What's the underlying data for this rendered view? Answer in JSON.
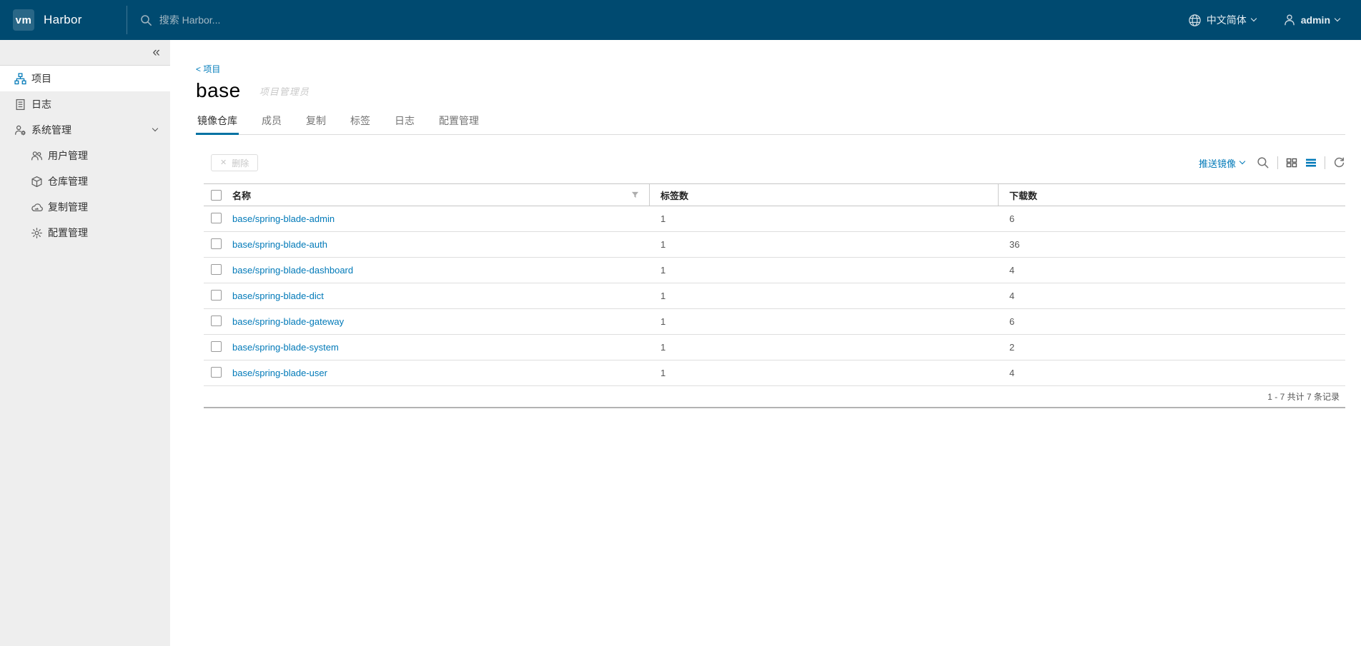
{
  "header": {
    "logo_text": "vm",
    "app_name": "Harbor",
    "search_placeholder": "搜索 Harbor...",
    "language_label": "中文简体",
    "user_label": "admin"
  },
  "sidebar": {
    "collapse_glyph": "«",
    "items": [
      {
        "label": "项目",
        "icon": "projects-icon",
        "active": true
      },
      {
        "label": "日志",
        "icon": "logs-icon"
      },
      {
        "label": "系统管理",
        "icon": "system-admin-icon",
        "expanded": true,
        "children": [
          {
            "label": "用户管理",
            "icon": "users-icon"
          },
          {
            "label": "仓库管理",
            "icon": "registry-icon"
          },
          {
            "label": "复制管理",
            "icon": "replication-icon"
          },
          {
            "label": "配置管理",
            "icon": "config-icon"
          }
        ]
      }
    ]
  },
  "page": {
    "breadcrumb": "< 项目",
    "title": "base",
    "role_label": "项目管理员",
    "tabs": [
      {
        "label": "镜像仓库",
        "active": true
      },
      {
        "label": "成员"
      },
      {
        "label": "复制"
      },
      {
        "label": "标签"
      },
      {
        "label": "日志"
      },
      {
        "label": "配置管理"
      }
    ]
  },
  "toolbar": {
    "delete_label": "删除",
    "delete_icon_glyph": "✕",
    "push_image_label": "推送镜像",
    "icons": [
      "search-icon",
      "card-view-icon",
      "list-view-icon",
      "refresh-icon"
    ]
  },
  "table": {
    "columns": [
      {
        "label": "名称",
        "filter_icon": "filter-icon"
      },
      {
        "label": "标签数"
      },
      {
        "label": "下载数"
      }
    ],
    "rows": [
      {
        "name": "base/spring-blade-admin",
        "tags": "1",
        "downloads": "6"
      },
      {
        "name": "base/spring-blade-auth",
        "tags": "1",
        "downloads": "36"
      },
      {
        "name": "base/spring-blade-dashboard",
        "tags": "1",
        "downloads": "4"
      },
      {
        "name": "base/spring-blade-dict",
        "tags": "1",
        "downloads": "4"
      },
      {
        "name": "base/spring-blade-gateway",
        "tags": "1",
        "downloads": "6"
      },
      {
        "name": "base/spring-blade-system",
        "tags": "1",
        "downloads": "2"
      },
      {
        "name": "base/spring-blade-user",
        "tags": "1",
        "downloads": "4"
      }
    ],
    "footer_text": "1 - 7 共计 7 条记录"
  },
  "colors": {
    "header_bg": "#004a70",
    "link": "#0079b8",
    "active_tab_underline": "#0072a3",
    "sidebar_bg": "#eeeeee"
  }
}
